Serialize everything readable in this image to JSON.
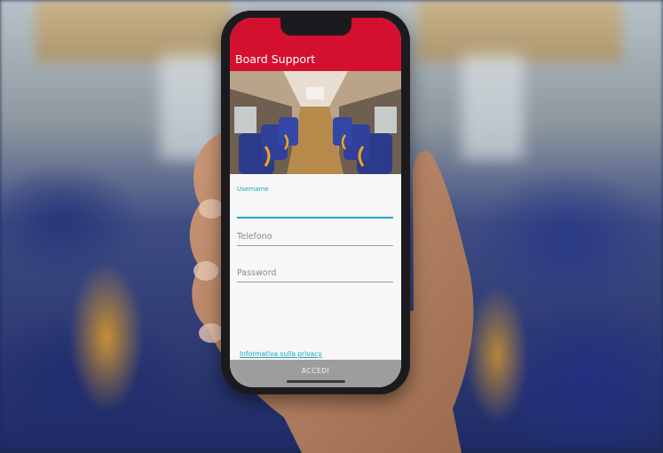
{
  "app": {
    "title": "Board Support"
  },
  "form": {
    "username_label": "Username",
    "telefono_placeholder": "Telefono",
    "password_placeholder": "Password",
    "privacy_link": "Informativa sulla privacy"
  },
  "bottom": {
    "primary_button": "ACCEDI"
  },
  "colors": {
    "appbar": "#d3102e",
    "accent": "#17a6c6",
    "button_bar": "#9d9d9d"
  }
}
